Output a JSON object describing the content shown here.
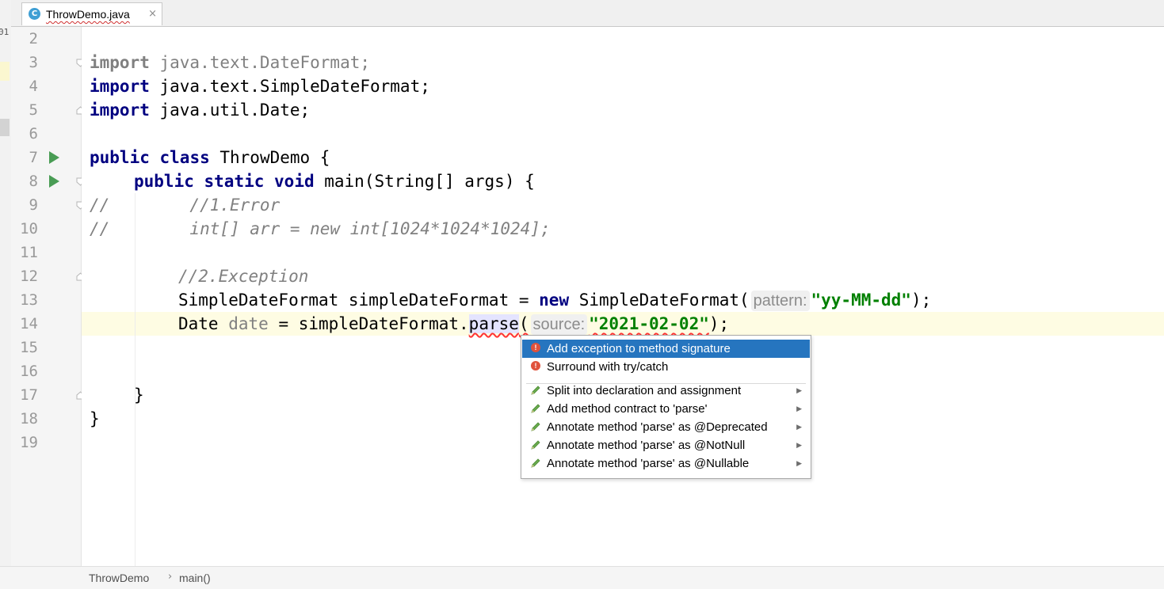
{
  "tab": {
    "file_name": "ThrowDemo.java",
    "close_symbol": "×",
    "icon_letter": "C"
  },
  "edge": {
    "text": "01"
  },
  "gutter": {
    "line_numbers": [
      "2",
      "3",
      "4",
      "5",
      "6",
      "7",
      "8",
      "9",
      "10",
      "11",
      "12",
      "13",
      "14",
      "15",
      "16",
      "17",
      "18",
      "19"
    ]
  },
  "code": {
    "line3": {
      "kw": "import",
      "rest": " java.text.DateFormat;"
    },
    "line4": {
      "kw": "import",
      "rest": " java.text.SimpleDateFormat;"
    },
    "line5": {
      "kw": "import",
      "rest": " java.util.Date;"
    },
    "line7": {
      "kw1": "public",
      "kw2": "class",
      "rest": " ThrowDemo {"
    },
    "line8": {
      "kw1": "public",
      "kw2": "static",
      "kw3": "void",
      "rest": " main(String[] args) {"
    },
    "line9": {
      "text": "//        //1.Error"
    },
    "line10": {
      "text": "//        int[] arr = new int[1024*1024*1024];"
    },
    "line12": {
      "text": "//2.Exception"
    },
    "line13": {
      "pre": "SimpleDateFormat simpleDateFormat = ",
      "kw": "new",
      "post": " SimpleDateFormat(",
      "hint": "pattern:",
      "str": "\"yy-MM-dd\"",
      "end": ");"
    },
    "line14": {
      "pre": "Date ",
      "unused": "date",
      "mid": " = simpleDateFormat.",
      "method": "parse",
      "paren": "(",
      "hint": "source:",
      "str": "\"2021-02-02\"",
      "end": ");"
    },
    "line17": {
      "text": "}"
    },
    "line18": {
      "text": "}"
    }
  },
  "popup": {
    "items": [
      {
        "label": "Add exception to method signature",
        "icon": "error-bulb-icon",
        "selected": true
      },
      {
        "label": "Surround with try/catch",
        "icon": "error-bulb-icon"
      },
      {
        "label": "Split into declaration and assignment",
        "icon": "intention-pencil-icon",
        "submenu": "▶"
      },
      {
        "label": "Add method contract to 'parse'",
        "icon": "intention-pencil-icon",
        "submenu": "▶"
      },
      {
        "label": "Annotate method 'parse' as @Deprecated",
        "icon": "intention-pencil-icon",
        "submenu": "▶"
      },
      {
        "label": "Annotate method 'parse' as @NotNull",
        "icon": "intention-pencil-icon",
        "submenu": "▶"
      },
      {
        "label": "Annotate method 'parse' as @Nullable",
        "icon": "intention-pencil-icon",
        "submenu": "▶"
      }
    ],
    "error_glyph": "!"
  },
  "breadcrumb": {
    "class_name": "ThrowDemo",
    "separator": "›",
    "method": "main()"
  },
  "colors": {
    "keyword": "#000080",
    "string": "#008000",
    "comment": "#808080",
    "selection": "#2675bf",
    "current_line": "#fefce3",
    "run": "#499c54"
  }
}
